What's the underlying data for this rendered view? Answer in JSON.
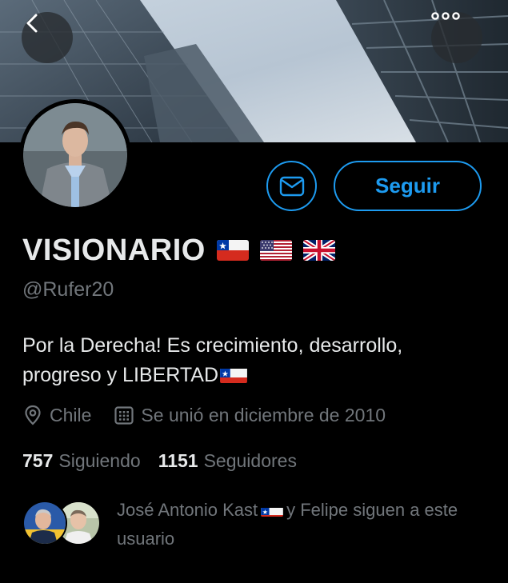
{
  "header": {
    "back_icon": "chevron-left-icon",
    "more_icon": "more-horizontal-icon"
  },
  "actions": {
    "message_icon": "envelope-icon",
    "follow_label": "Seguir",
    "accent_color": "#1d9bf0"
  },
  "profile": {
    "name": "VISIONARIO",
    "name_flags": [
      "chile-flag",
      "usa-flag",
      "uk-flag"
    ],
    "handle": "@Rufer20",
    "bio_text": "Por la Derecha! Es crecimiento, desarrollo, progreso y LIBERTAD",
    "bio_flag": "chile-flag",
    "location": "Chile",
    "location_icon": "location-pin-icon",
    "joined": "Se unió en diciembre de 2010",
    "joined_icon": "calendar-icon"
  },
  "stats": {
    "following_count": "757",
    "following_label": "Siguiendo",
    "followers_count": "1151",
    "followers_label": "Seguidores"
  },
  "followed_by": {
    "first_name": "José Antonio Kast",
    "rest_text": "y Felipe siguen a este usuario"
  }
}
